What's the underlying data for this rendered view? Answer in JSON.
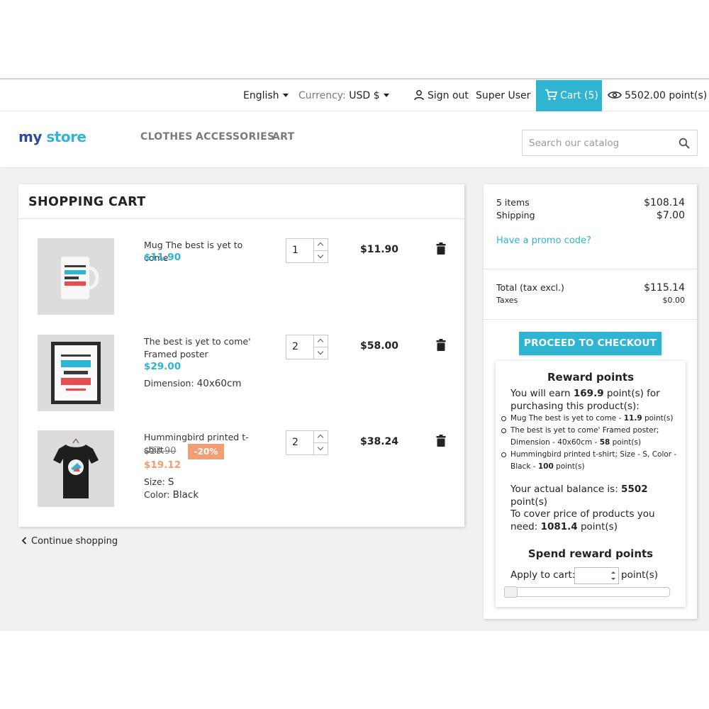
{
  "top_nav": {
    "language": "English",
    "currency_label": "Currency:",
    "currency_value": "USD $",
    "sign_out": "Sign out",
    "user_name": "Super User",
    "cart_label": "Cart (5)",
    "points": "5502.00 point(s)"
  },
  "header": {
    "logo_part1": "my",
    "logo_part2": "store",
    "menu": [
      "CLOTHES",
      "ACCESSORIES",
      "ART"
    ],
    "search_placeholder": "Search our catalog"
  },
  "cart": {
    "title": "SHOPPING CART",
    "items": [
      {
        "name": "Mug The best is yet to come",
        "price": "$11.90",
        "qty": "1",
        "total": "$11.90"
      },
      {
        "name": "The best is yet to come' Framed poster",
        "price": "$29.00",
        "attr_label": "Dimension:",
        "attr_value": "40x60cm",
        "qty": "2",
        "total": "$58.00"
      },
      {
        "name": "Hummingbird printed t-shirt",
        "old_price": "$23.90",
        "discount": "-20%",
        "price": "$19.12",
        "size_label": "Size:",
        "size_value": "S",
        "color_label": "Color:",
        "color_value": "Black",
        "qty": "2",
        "total": "$38.24"
      }
    ],
    "continue": "Continue shopping"
  },
  "summary": {
    "items_label": "5 items",
    "items_value": "$108.14",
    "shipping_label": "Shipping",
    "shipping_value": "$7.00",
    "promo": "Have a promo code?",
    "total_label": "Total (tax excl.)",
    "total_value": "$115.14",
    "taxes_label": "Taxes",
    "taxes_value": "$0.00",
    "checkout": "PROCEED TO CHECKOUT"
  },
  "reward": {
    "title": "Reward points",
    "earn_pre": "You will earn ",
    "earn_value": "169.9",
    "earn_post": " point(s) for purchasing this product(s):",
    "list": [
      {
        "text": "Mug The best is yet to come - ",
        "pts": "11.9",
        "suffix": " point(s)"
      },
      {
        "text": "The best is yet to come' Framed poster; Dimension - 40x60cm - ",
        "pts": "58",
        "suffix": " point(s)"
      },
      {
        "text": "Hummingbird printed t-shirt; Size - S, Color - Black - ",
        "pts": "100",
        "suffix": " point(s)"
      }
    ],
    "balance_pre": "Your actual balance is: ",
    "balance_value": "5502",
    "balance_post": " point(s)",
    "cover_pre": "To cover price of products you need: ",
    "cover_value": "1081.4",
    "cover_post": " point(s)",
    "spend_title": "Spend reward points",
    "apply_label": "Apply to cart:",
    "apply_suffix": "point(s)",
    "slider_value": 0
  },
  "colors": {
    "accent": "#2fb5d2",
    "discount": "#f39d72",
    "logo_blue": "#2fb5d2",
    "logo_red": "#ff4c4c"
  }
}
